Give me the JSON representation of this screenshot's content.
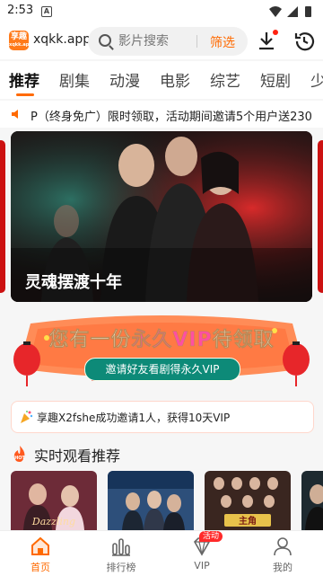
{
  "status": {
    "time": "2:53",
    "app_icon_letter": "A"
  },
  "header": {
    "logo_text": "享趣",
    "site_name": "xqkk.app",
    "search_placeholder": "影片搜索",
    "filter_label": "筛选"
  },
  "tabs": [
    {
      "label": "推荐"
    },
    {
      "label": "剧集"
    },
    {
      "label": "动漫"
    },
    {
      "label": "电影"
    },
    {
      "label": "综艺"
    },
    {
      "label": "短剧"
    },
    {
      "label": "少"
    }
  ],
  "notice": {
    "text": "P（终身免广）限时领取，活动期间邀请5个用户送230"
  },
  "banner": {
    "caption": "灵魂摆渡十年"
  },
  "vip_banner": {
    "title_prefix": "您有一份",
    "title_highlight": "永久VIP",
    "title_suffix": "待领取",
    "button_label": "邀请好友看剧得永久VIP"
  },
  "invite": {
    "text": "享趣X2fshe成功邀请1人，获得10天VIP"
  },
  "section": {
    "title": "实时观看推荐"
  },
  "posters": [
    {
      "name": "poster-1",
      "overlay_text": "Dazzling"
    },
    {
      "name": "poster-2",
      "overlay_text": ""
    },
    {
      "name": "poster-3",
      "overlay_text": "主角"
    },
    {
      "name": "poster-4",
      "overlay_text": ""
    }
  ],
  "bottom_nav": [
    {
      "label": "首页",
      "icon": "home-icon",
      "active": true
    },
    {
      "label": "排行榜",
      "icon": "ranking-icon"
    },
    {
      "label": "VIP",
      "icon": "vip-diamond-icon",
      "badge": "活动"
    },
    {
      "label": "我的",
      "icon": "profile-icon"
    }
  ],
  "colors": {
    "accent": "#ff6a00",
    "badge": "#ff2a2a"
  }
}
